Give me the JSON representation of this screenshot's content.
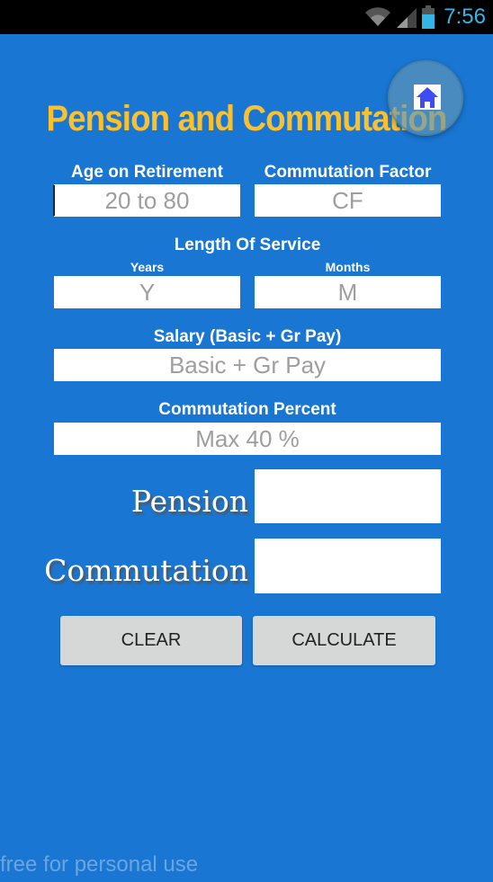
{
  "status_bar": {
    "time": "7:56",
    "icons": [
      "wifi-icon",
      "signal-icon",
      "battery-icon"
    ],
    "time_color": "#33b5e5"
  },
  "app": {
    "title": "Pension and Commutation",
    "home_button_icon": "home-icon",
    "accent_color": "#fbc02d",
    "background_color": "#1976d2"
  },
  "form": {
    "age": {
      "label": "Age on Retirement",
      "placeholder": "20 to 80",
      "value": ""
    },
    "cf": {
      "label": "Commutation Factor",
      "placeholder": "CF",
      "value": ""
    },
    "service": {
      "label": "Length Of Service",
      "years": {
        "label": "Years",
        "placeholder": "Y",
        "value": ""
      },
      "months": {
        "label": "Months",
        "placeholder": "M",
        "value": ""
      }
    },
    "salary": {
      "label": "Salary (Basic + Gr Pay)",
      "placeholder": "Basic + Gr Pay",
      "value": ""
    },
    "commutation_percent": {
      "label": "Commutation Percent",
      "placeholder": "Max 40 %",
      "value": ""
    }
  },
  "results": {
    "pension": {
      "label": "Pension",
      "value": ""
    },
    "commutation": {
      "label": "Commutation",
      "value": ""
    }
  },
  "buttons": {
    "clear": "CLEAR",
    "calculate": "CALCULATE"
  },
  "footer": "free for personal use"
}
